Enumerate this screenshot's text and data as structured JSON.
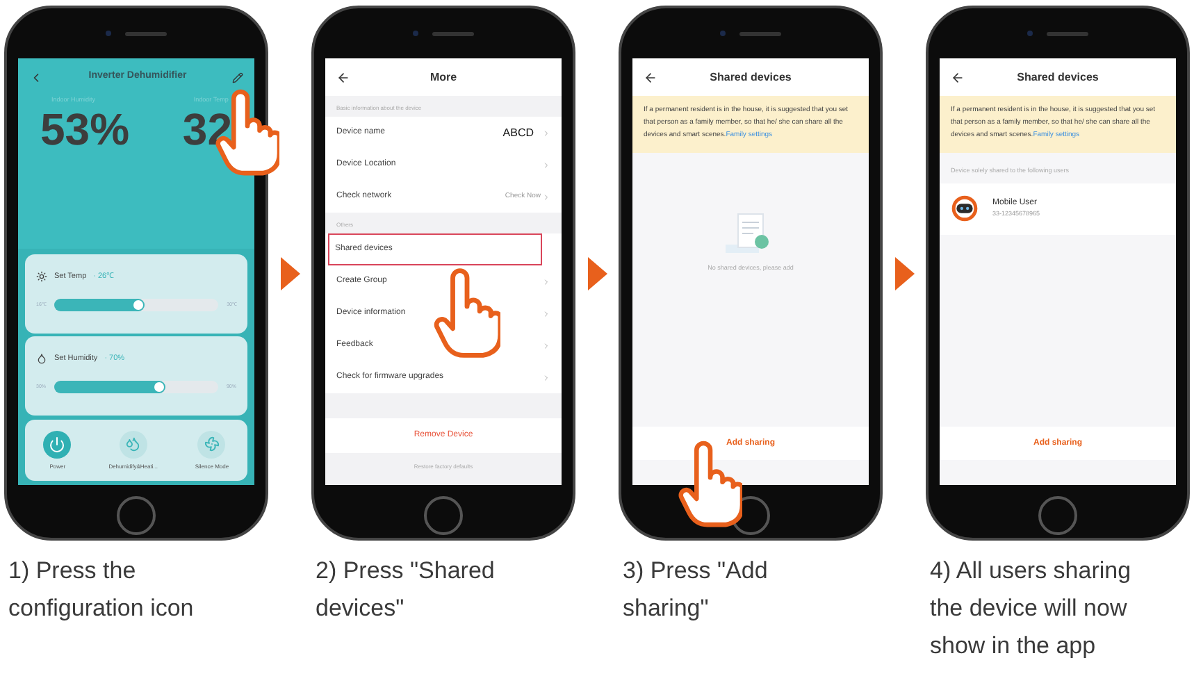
{
  "steps": [
    {
      "kind": "device_control",
      "hand": true,
      "caption": "1) Press the configuration icon",
      "title": "Inverter Dehumidifier",
      "readings": [
        {
          "label": "Indoor Humidity",
          "value": "53%"
        },
        {
          "label": "Indoor Temp",
          "value": "32"
        }
      ],
      "settings": [
        {
          "kind": "temp",
          "label": "Set Temp",
          "value": "· 26℃",
          "min": "16℃",
          "max": "30℃",
          "level": 0.55
        },
        {
          "kind": "humidity",
          "label": "Set Humidity",
          "value": "· 70%",
          "min": "30%",
          "max": "90%",
          "level": 0.68
        }
      ],
      "modes": [
        {
          "kind": "power",
          "label": "Power",
          "on": true
        },
        {
          "kind": "dehumidify",
          "label": "Dehumidify&Heati...",
          "on": false
        },
        {
          "kind": "fan",
          "label": "Silence Mode",
          "on": false
        }
      ]
    },
    {
      "kind": "menu",
      "hand": true,
      "caption": "2) Press \"Shared devices\"",
      "title": "More",
      "sections": [
        {
          "header": "Basic information about the device",
          "rows": [
            {
              "label": "Device name",
              "value": "ABCD",
              "highlighted": false
            },
            {
              "label": "Device Location",
              "highlighted": false
            },
            {
              "label": "Check network",
              "value": "Check Now",
              "highlighted": false
            }
          ]
        },
        {
          "header": "Others",
          "rows": [
            {
              "label": "Shared devices",
              "highlighted": true
            },
            {
              "label": "Create Group",
              "highlighted": false
            },
            {
              "label": "Device information",
              "highlighted": false
            },
            {
              "label": "Feedback",
              "highlighted": false
            },
            {
              "label": "Check for firmware upgrades",
              "highlighted": false
            }
          ]
        }
      ],
      "remove": "Remove Device",
      "footer": "Restore factory defaults"
    },
    {
      "kind": "sharing",
      "hand": true,
      "caption": "3) Press \"Add sharing\"",
      "title": "Shared devices",
      "notice": "If a permanent resident is in the house, it is suggested that you set that person as a family member, so that he/ she can share all the devices and smart scenes.",
      "notice_link": "Family settings",
      "empty": "No shared devices, please add",
      "button": "Add sharing"
    },
    {
      "kind": "sharing",
      "hand": false,
      "caption": "4) All users sharing the device will now show in the app",
      "title": "Shared devices",
      "notice": "If a permanent resident is in the house, it is suggested that you set that person as a family member, so that he/ she can share all the devices and smart scenes.",
      "notice_link": "Family settings",
      "list_header": "Device solely shared to the following users",
      "users": [
        {
          "name": "Mobile User",
          "phone": "33-12345678965"
        }
      ],
      "button": "Add sharing"
    }
  ]
}
